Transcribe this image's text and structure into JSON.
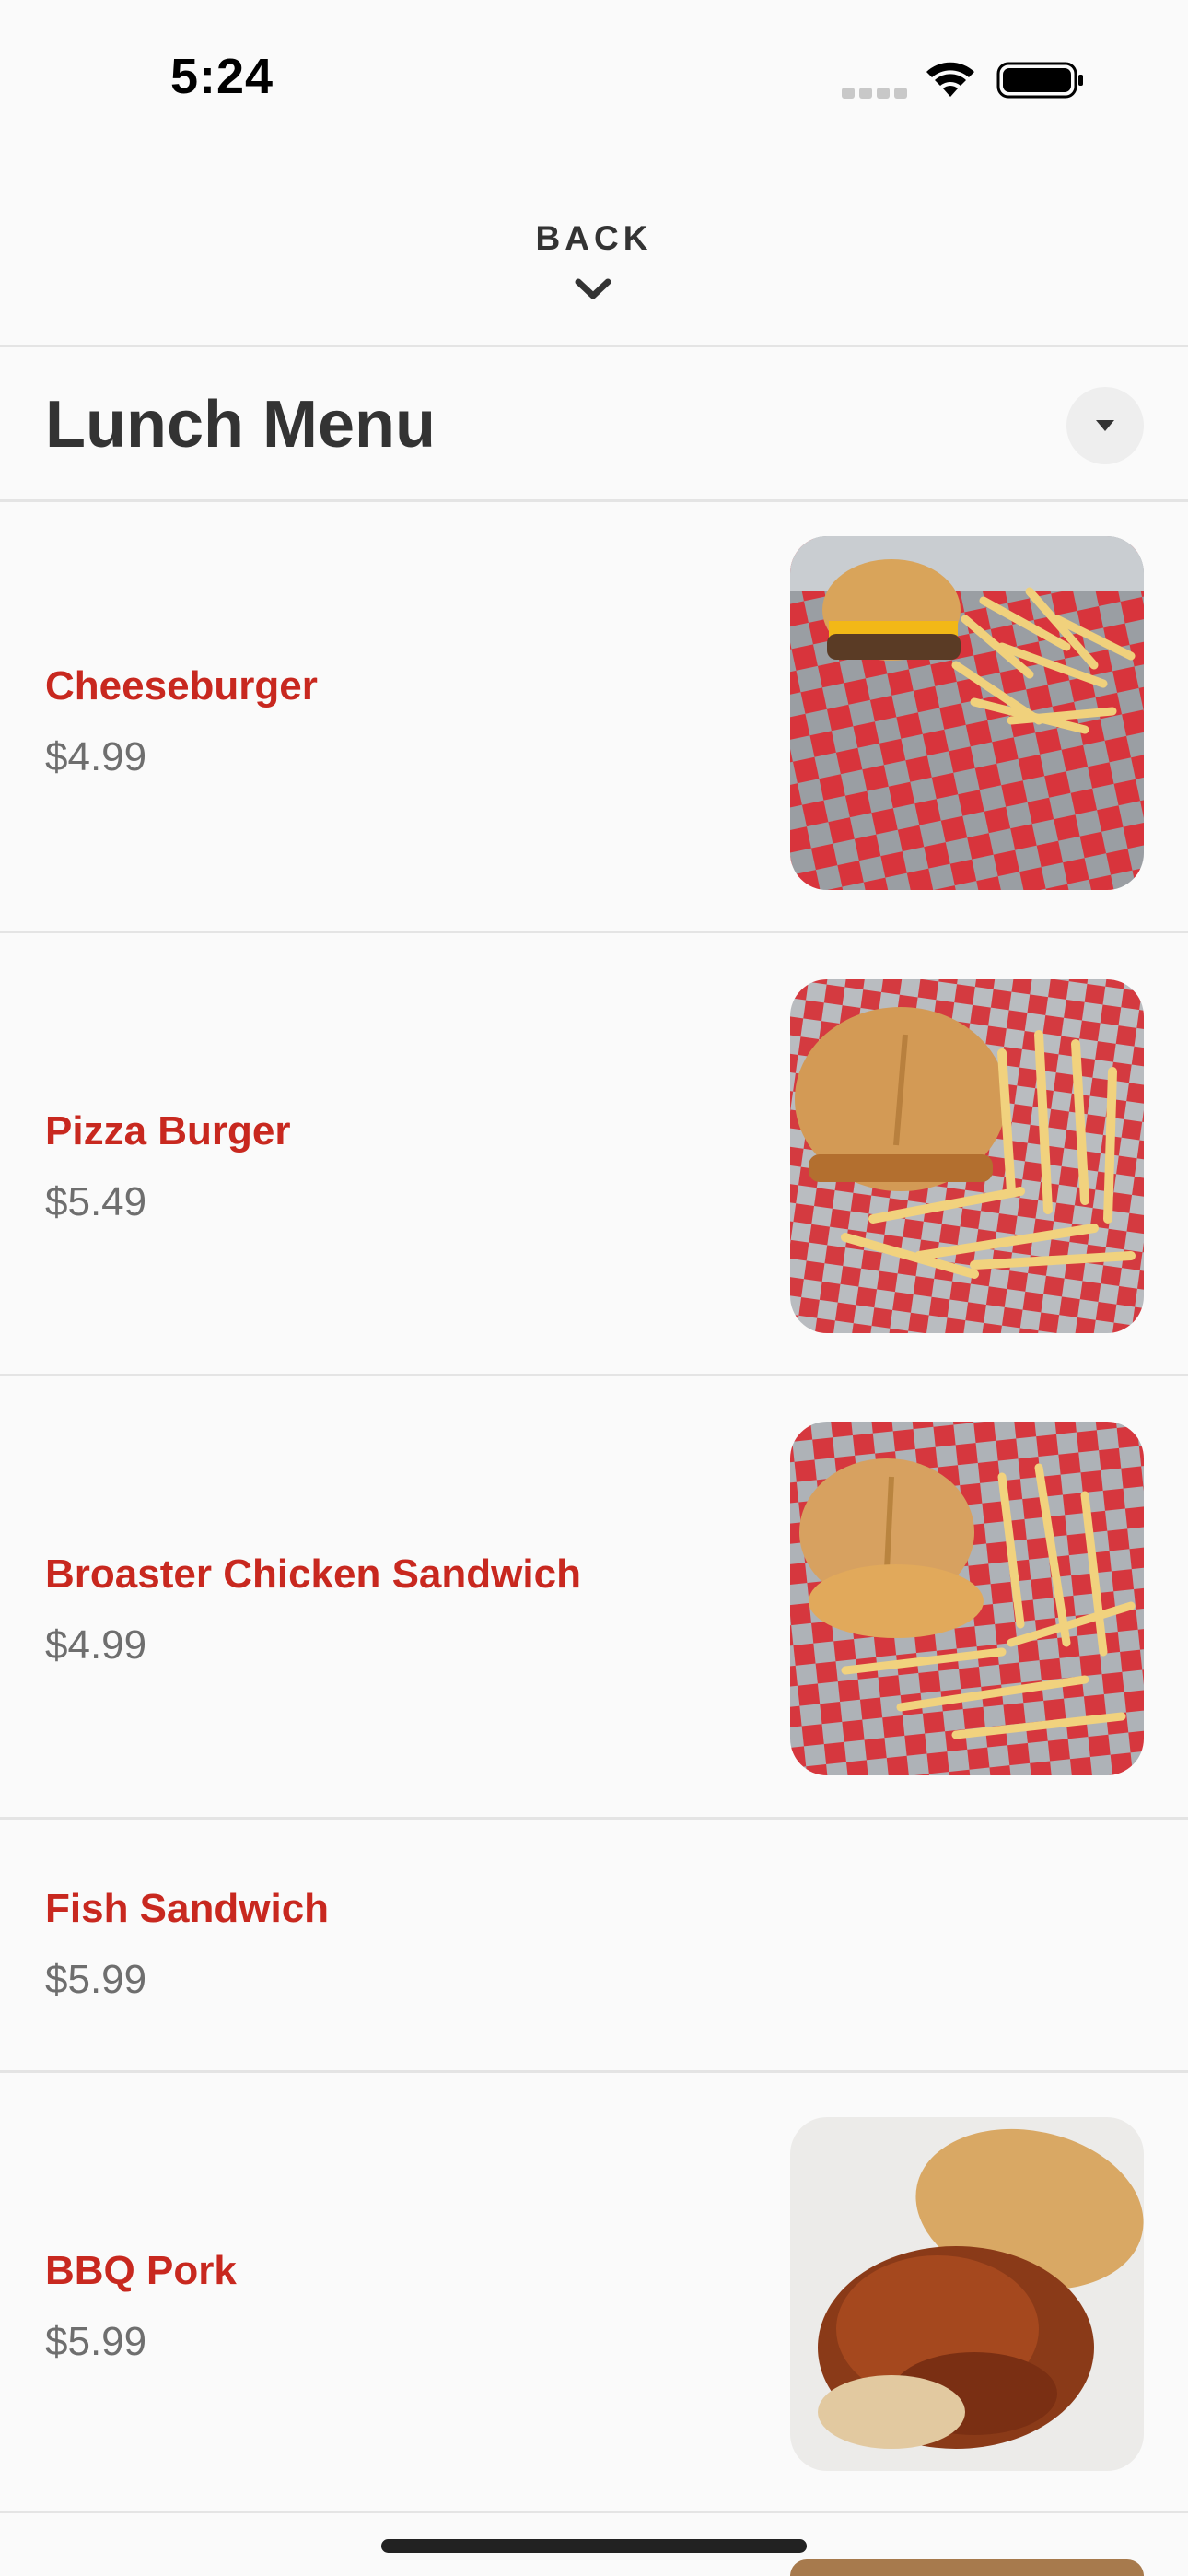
{
  "status": {
    "time": "5:24"
  },
  "nav": {
    "back_label": "BACK"
  },
  "menu": {
    "title": "Lunch Menu"
  },
  "items": [
    {
      "name": "Cheeseburger",
      "price": "$4.99",
      "has_image": true
    },
    {
      "name": "Pizza Burger",
      "price": "$5.49",
      "has_image": true
    },
    {
      "name": "Broaster Chicken Sandwich",
      "price": "$4.99",
      "has_image": true
    },
    {
      "name": "Fish Sandwich",
      "price": "$5.99",
      "has_image": false
    },
    {
      "name": "BBQ Pork",
      "price": "$5.99",
      "has_image": true
    }
  ],
  "colors": {
    "accent": "#c8281f",
    "price": "#6e6e6e",
    "title": "#333333"
  }
}
